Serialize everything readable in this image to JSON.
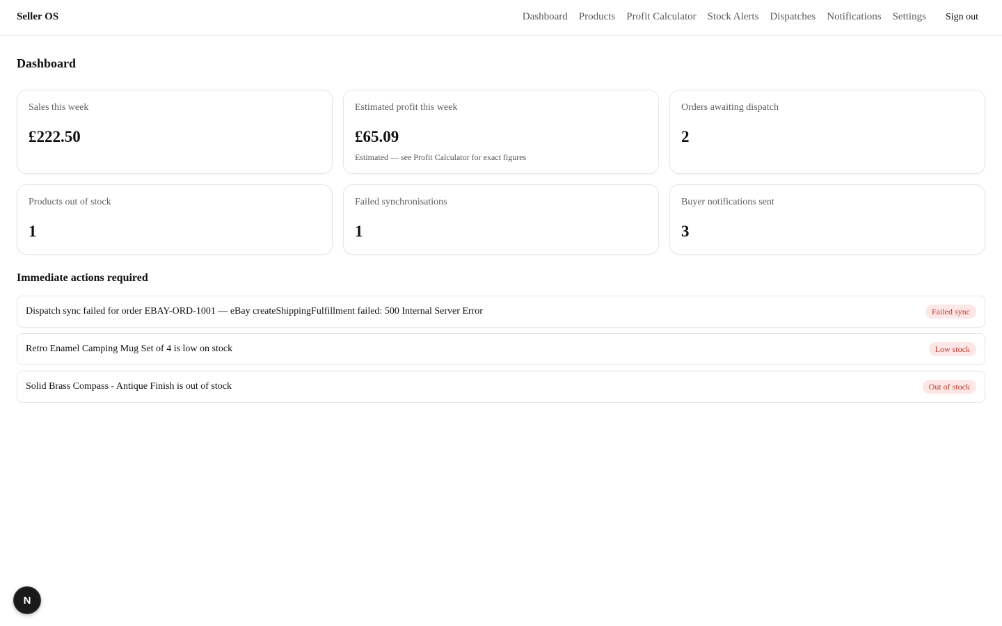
{
  "header": {
    "brand": "Seller OS",
    "nav": [
      {
        "label": "Dashboard"
      },
      {
        "label": "Products"
      },
      {
        "label": "Profit Calculator"
      },
      {
        "label": "Stock Alerts"
      },
      {
        "label": "Dispatches"
      },
      {
        "label": "Notifications"
      },
      {
        "label": "Settings"
      }
    ],
    "sign_out": "Sign out"
  },
  "main": {
    "title": "Dashboard",
    "stats": [
      {
        "label": "Sales this week",
        "value": "£222.50"
      },
      {
        "label": "Estimated profit this week",
        "value": "£65.09",
        "note": "Estimated — see Profit Calculator for exact figures"
      },
      {
        "label": "Orders awaiting dispatch",
        "value": "2"
      },
      {
        "label": "Products out of stock",
        "value": "1"
      },
      {
        "label": "Failed synchronisations",
        "value": "1"
      },
      {
        "label": "Buyer notifications sent",
        "value": "3"
      }
    ],
    "actions_title": "Immediate actions required",
    "actions": [
      {
        "text": "Dispatch sync failed for order EBAY-ORD-1001 — eBay createShippingFulfillment failed: 500 Internal Server Error",
        "badge": "Failed sync"
      },
      {
        "text": "Retro Enamel Camping Mug Set of 4 is low on stock",
        "badge": "Low stock"
      },
      {
        "text": "Solid Brass Compass - Antique Finish is out of stock",
        "badge": "Out of stock"
      }
    ]
  },
  "dev_badge": {
    "icon": "n-logo-icon",
    "letter": "N"
  },
  "colors": {
    "badge_text": "#c0392b",
    "badge_bg": "#fde6e6",
    "border": "#e4e4e4"
  }
}
